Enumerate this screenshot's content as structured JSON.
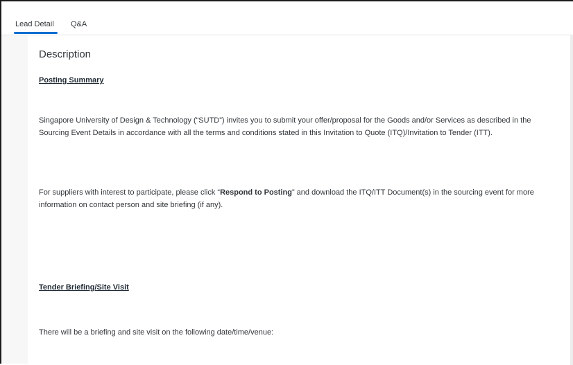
{
  "tabs": {
    "lead_detail": "Lead Detail",
    "qa": "Q&A"
  },
  "description": {
    "title": "Description",
    "posting_summary": "Posting Summary",
    "invite_text": "Singapore University of Design & Technology (“SUTD”) invites you to submit your offer/proposal for the Goods and/or Services as described in the Sourcing Event Details in accordance with all the terms and conditions stated in this Invitation to Quote (ITQ)/Invitation to Tender (ITT).",
    "respond_before": "For suppliers with interest to participate, please click “",
    "respond_bold": "Respond to Posting",
    "respond_after": "” and download the ITQ/ITT Document(s) in the sourcing event for more information on contact person and site briefing (if any).",
    "tender_briefing": "Tender Briefing/Site Visit",
    "briefing_text": "There will be a briefing and site visit on the following date/time/venue:"
  },
  "colors": {
    "accent": "#0a6ed1",
    "text": "#32363a",
    "background": "#f7f7f7"
  }
}
